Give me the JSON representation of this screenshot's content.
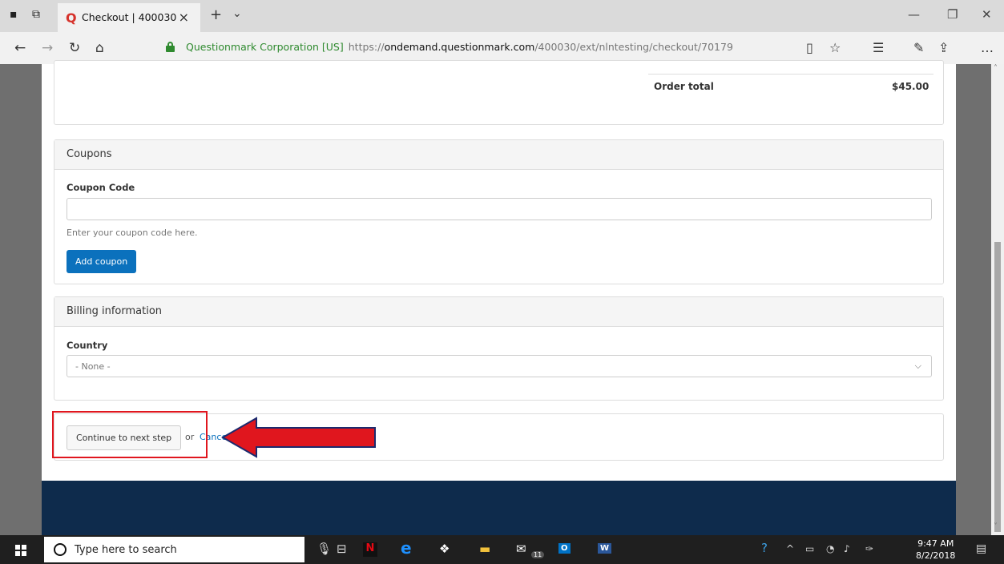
{
  "browser": {
    "tab_title": "Checkout | 400030",
    "url_org": "Questionmark Corporation [US]",
    "url_proto": "https://",
    "url_host": "ondemand.questionmark.com",
    "url_path": "/400030/ext/nlntesting/checkout/70179"
  },
  "order": {
    "total_label": "Order total",
    "total_value": "$45.00"
  },
  "coupons": {
    "heading": "Coupons",
    "field_label": "Coupon Code",
    "value": "",
    "help": "Enter your coupon code here.",
    "button": "Add coupon"
  },
  "billing": {
    "heading": "Billing information",
    "country_label": "Country",
    "country_selected": "- None -"
  },
  "actions": {
    "continue": "Continue to next step",
    "or": "or",
    "cancel": "Cancel"
  },
  "annotation": {
    "color": "#e0161e"
  },
  "taskbar": {
    "search_placeholder": "Type here to search",
    "mail_badge": "11",
    "time": "9:47 AM",
    "date": "8/2/2018"
  }
}
